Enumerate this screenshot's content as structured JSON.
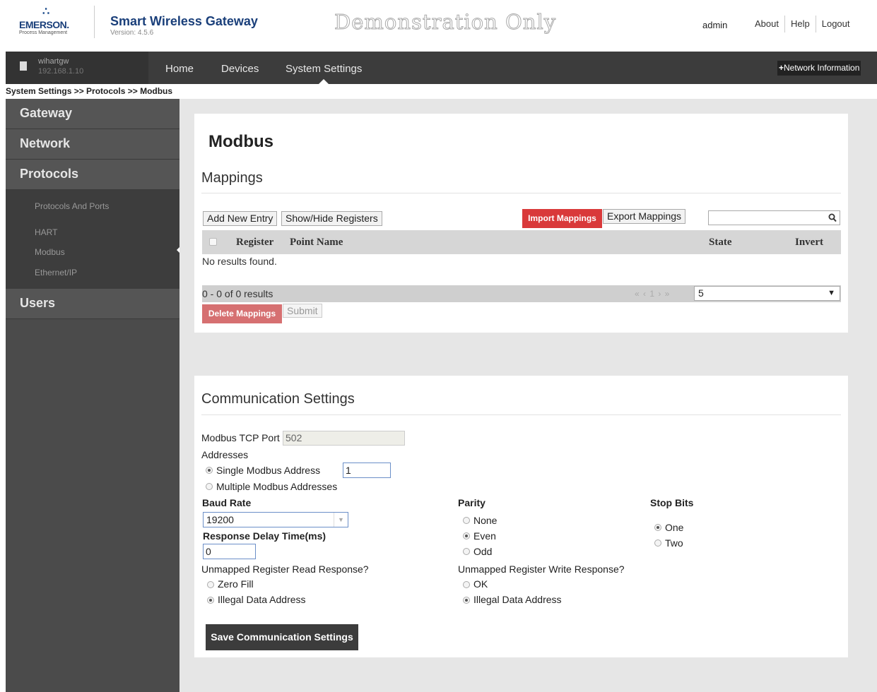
{
  "header": {
    "logo_name": "EMERSON.",
    "logo_sub": "Process Management",
    "app_title": "Smart Wireless Gateway",
    "version": "Version: 4.5.6",
    "watermark": "Demonstration Only",
    "user": "admin",
    "links": [
      "About",
      "Help",
      "Logout"
    ]
  },
  "navbar": {
    "gateway_name": "wihartgw",
    "gateway_ip": "192.168.1.10",
    "items": [
      "Home",
      "Devices",
      "System Settings"
    ],
    "active": "System Settings",
    "network_info": "Network Information"
  },
  "breadcrumb": "System Settings >> Protocols >> Modbus",
  "sidebar": {
    "sections": [
      "Gateway",
      "Network",
      "Protocols",
      "Users"
    ],
    "protocol_items": [
      "Protocols And Ports",
      "HART",
      "Modbus",
      "Ethernet/IP"
    ],
    "active_item": "Modbus"
  },
  "mappings": {
    "page_title": "Modbus",
    "section_title": "Mappings",
    "buttons": {
      "add_new_entry": "Add New Entry",
      "show_hide_registers": "Show/Hide Registers",
      "import_mappings": "Import Mappings",
      "export_mappings": "Export Mappings",
      "delete_mappings": "Delete Mappings",
      "submit": "Submit"
    },
    "search_value": "",
    "columns": [
      "Register",
      "Point Name",
      "State",
      "Invert"
    ],
    "empty_text": "No results found.",
    "pager": {
      "count_text": "0 - 0 of 0 results",
      "nav": "« ‹ 1 › »",
      "page_size": "5"
    }
  },
  "comm": {
    "section_title": "Communication Settings",
    "tcp_port_label": "Modbus TCP Port",
    "tcp_port_value": "502",
    "addresses_label": "Addresses",
    "single_address_label": "Single Modbus Address",
    "single_address_value": "1",
    "multiple_address_label": "Multiple Modbus Addresses",
    "address_mode": "single",
    "baud_rate_label": "Baud Rate",
    "baud_rate_value": "19200",
    "response_delay_label": "Response Delay Time(ms)",
    "response_delay_value": "0",
    "parity_label": "Parity",
    "parity_options": [
      "None",
      "Even",
      "Odd"
    ],
    "parity_value": "Even",
    "stop_bits_label": "Stop Bits",
    "stop_bits_options": [
      "One",
      "Two"
    ],
    "stop_bits_value": "One",
    "read_response_label": "Unmapped Register Read Response?",
    "read_response_options": [
      "Zero Fill",
      "Illegal Data Address"
    ],
    "read_response_value": "Illegal Data Address",
    "write_response_label": "Unmapped Register Write Response?",
    "write_response_options": [
      "OK",
      "Illegal Data Address"
    ],
    "write_response_value": "Illegal Data Address",
    "save_button": "Save Communication Settings"
  },
  "icons": {
    "search": "search-icon",
    "plus": "plus-icon",
    "gateway": "gateway-icon",
    "dropdown": "chevron-down-icon"
  }
}
